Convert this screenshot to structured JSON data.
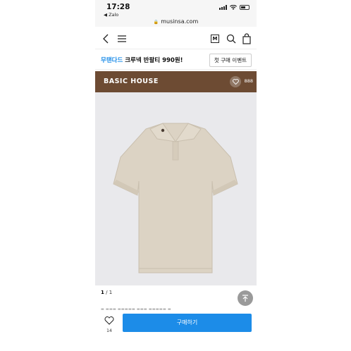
{
  "status_bar": {
    "time": "17:28",
    "back_app": "◀ Zalo",
    "url": "musinsa.com"
  },
  "nav": {
    "m_label": "M"
  },
  "promo": {
    "accent_text": "무탠다드",
    "text": " 크루넥 반팔티 990원!",
    "event_button": "첫 구매 이벤트"
  },
  "brand": {
    "name": "BASIC HOUSE",
    "like_count": "888",
    "background": "#6d4b33"
  },
  "product": {
    "image": "beige-polo-shirt",
    "page_current": "1",
    "page_total": "/ 1"
  },
  "bottom": {
    "like_count": "14",
    "buy_label": "구매하기",
    "buy_color": "#1c8ce8"
  }
}
